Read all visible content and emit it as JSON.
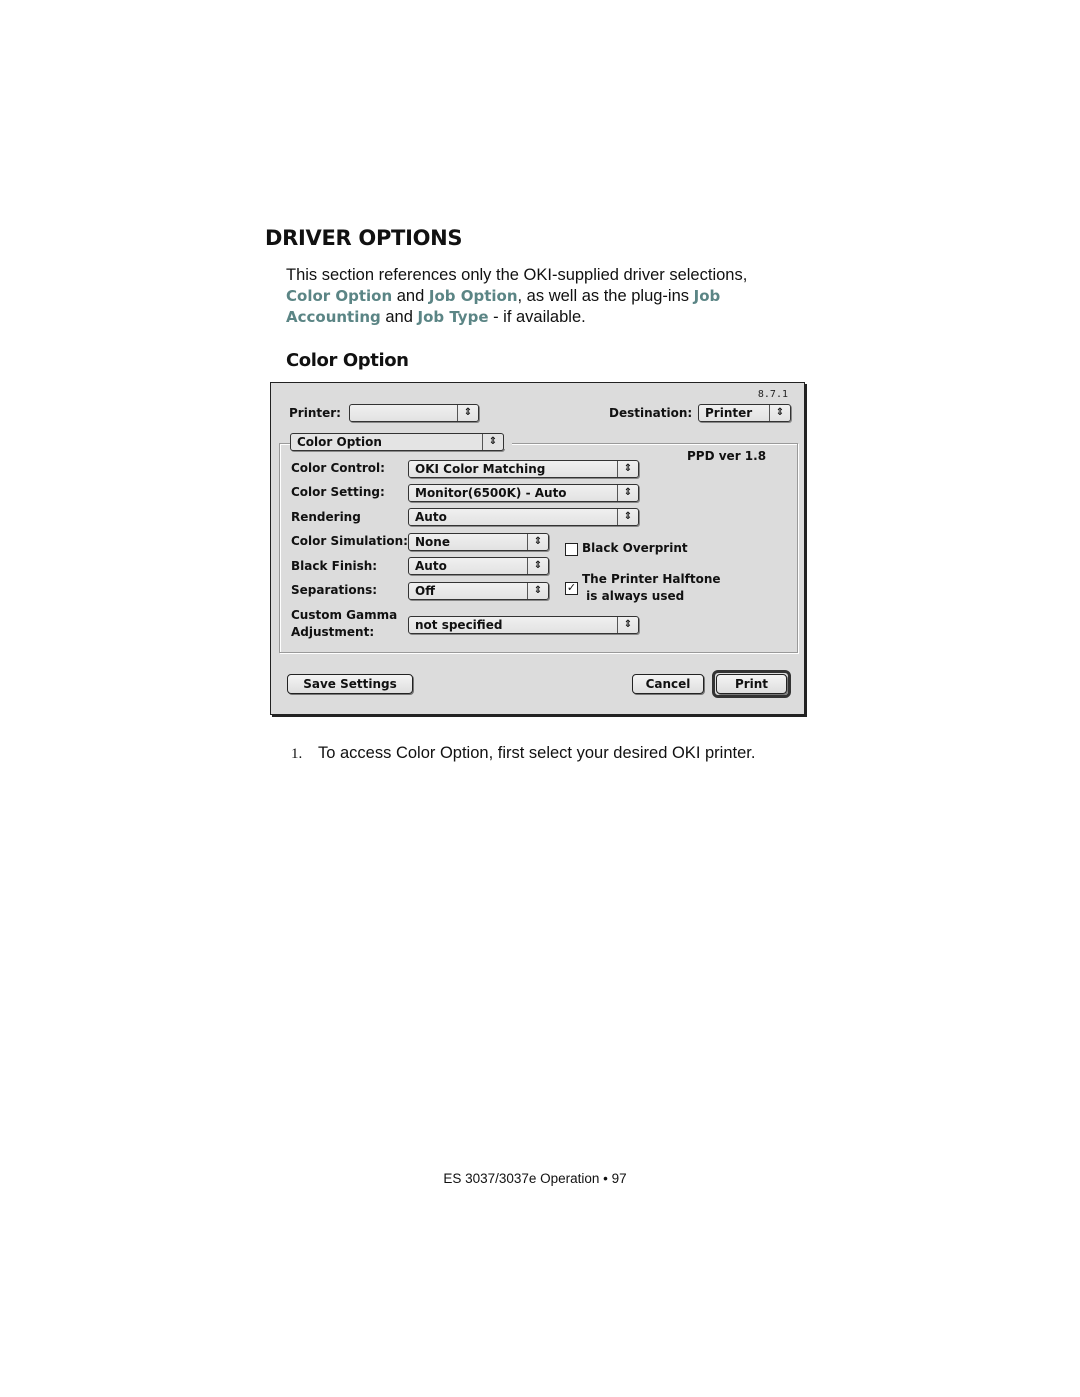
{
  "page": {
    "heading": "DRIVER OPTIONS",
    "intro": {
      "part1": "This section references only the OKI-supplied driver selections,",
      "link1": "Color Option",
      "part2": " and ",
      "link2": "Job Option",
      "part3": ", as well as the plug-ins ",
      "link3": "Job Accounting",
      "part4": " and ",
      "link4": "Job Type",
      "part5": " - if available."
    },
    "subheading": "Color Option",
    "step": {
      "number": "1.",
      "text": "To access Color Option, first select your desired OKI printer."
    },
    "footer": "ES 3037/3037e  Operation • 97",
    "colors": {
      "highlight": "#5b8585",
      "dialog_bg": "#dcdcdc"
    }
  },
  "dialog": {
    "version": "8.7.1",
    "printer": {
      "label": "Printer:",
      "value": ""
    },
    "destination": {
      "label": "Destination:",
      "value": "Printer"
    },
    "panel_select": {
      "value": "Color Option"
    },
    "ppd_version": "PPD ver 1.8",
    "fields": [
      {
        "label": "Color Control:",
        "value": "OKI Color Matching"
      },
      {
        "label": "Color Setting:",
        "value": "Monitor(6500K) - Auto"
      },
      {
        "label": "Rendering",
        "value": "Auto"
      },
      {
        "label": "Color Simulation:",
        "value": "None"
      },
      {
        "label": "Black Finish:",
        "value": "Auto"
      },
      {
        "label": "Separations:",
        "value": "Off"
      },
      {
        "label_line1": "Custom Gamma",
        "label_line2": "Adjustment:",
        "value": "not specified"
      }
    ],
    "checkboxes": [
      {
        "label": "Black Overprint",
        "checked": false,
        "mark": ""
      },
      {
        "label_line1": "The Printer Halftone",
        "label_line2": " is always used",
        "checked": true,
        "mark": "✓"
      }
    ],
    "arrows_glyph": "⇕",
    "buttons": {
      "save": "Save Settings",
      "cancel": "Cancel",
      "print": "Print"
    }
  }
}
